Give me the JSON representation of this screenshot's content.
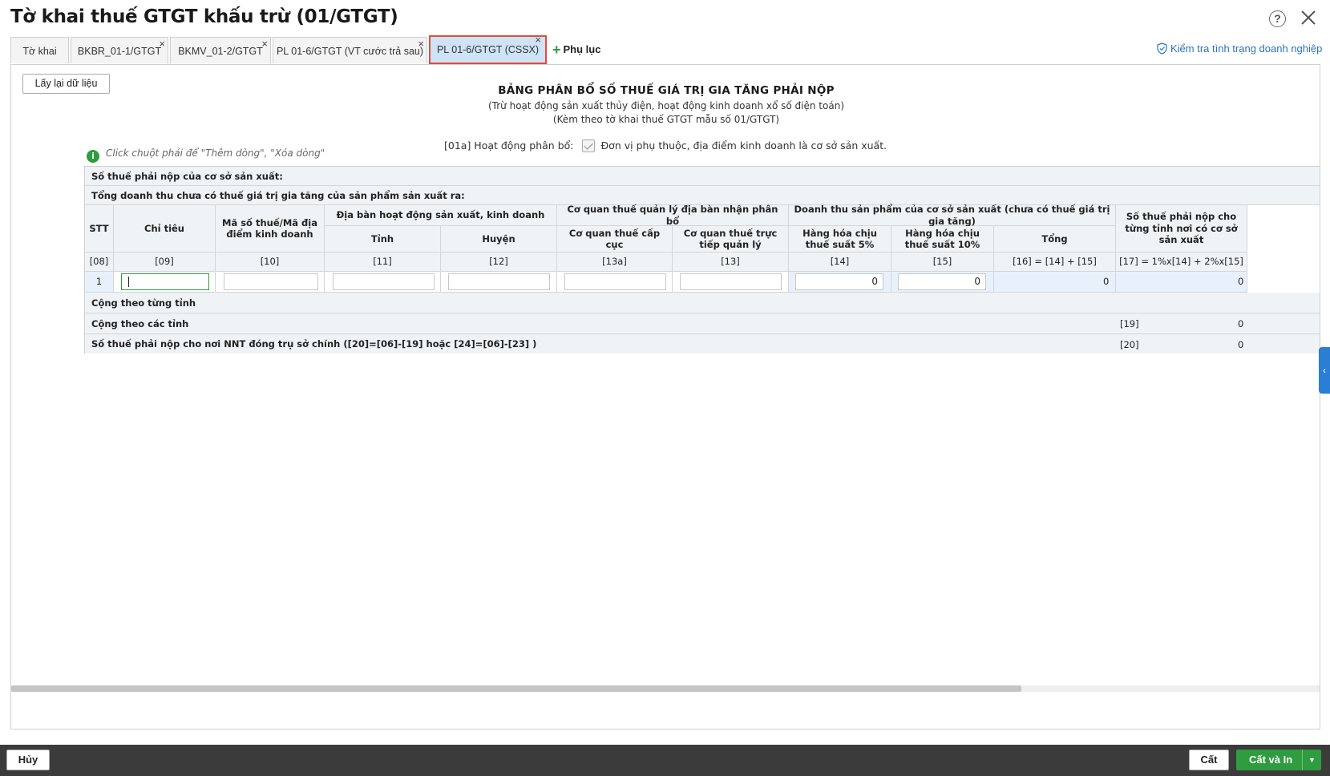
{
  "window": {
    "title": "Tờ khai thuế GTGT khấu trừ (01/GTGT)",
    "help_icon": "?"
  },
  "tabs": [
    {
      "label": "Tờ khai"
    },
    {
      "label": "BKBR_01-1/GTGT"
    },
    {
      "label": "BKMV_01-2/GTGT"
    },
    {
      "label": "PL 01-6/GTGT (VT cước trả sau)"
    },
    {
      "label": "PL 01-6/GTGT (CSSX)"
    }
  ],
  "tab_close_glyph": "×",
  "add_tab": {
    "plus": "+",
    "label": "Phụ lục"
  },
  "check_link": {
    "label": "Kiểm tra tình trạng doanh nghiệp"
  },
  "reload_button": {
    "label": "Lấy lại dữ liệu"
  },
  "form": {
    "title": "BẢNG PHÂN BỔ SỐ THUẾ GIÁ TRỊ GIA TĂNG PHẢI NỘP",
    "subtitle1": "(Trừ hoạt động sản xuất thủy điện, hoạt động kinh doanh xổ số điện toán)",
    "subtitle2": "(Kèm theo tờ khai thuế GTGT mẫu số 01/GTGT)",
    "alloc_label": "[01a] Hoạt động phân bổ:",
    "alloc_checkbox_label": "Đơn vị phụ thuộc, địa điểm kinh doanh là cơ sở sản xuất.",
    "alloc_checked": true,
    "hint_icon": "i",
    "hint": "Click chuột phải để \"Thêm dòng\", \"Xóa dòng\""
  },
  "grid": {
    "bar1": "Số thuế phải nộp của cơ sở sản xuất:",
    "bar2": "Tổng doanh thu chưa có thuế giá trị gia tăng của sản phẩm sản xuất ra:",
    "headers": {
      "stt": "STT",
      "chi_tieu": "Chỉ tiêu",
      "mst": "Mã số thuế/Mã địa điểm kinh doanh",
      "dia_ban": "Địa bàn hoạt động sản xuất, kinh doanh",
      "tinh": "Tỉnh",
      "huyen": "Huyện",
      "co_quan": "Cơ quan thuế quản lý địa bàn nhận phân bổ",
      "cap_cuc": "Cơ quan thuế cấp cục",
      "truc_tiep": "Cơ quan thuế trực tiếp quản lý",
      "doanh_thu": "Doanh thu sản phẩm của cơ sở sản xuất (chưa có thuế giá trị gia tăng)",
      "hh5": "Hàng hóa chịu thuế suất 5%",
      "hh10": "Hàng hóa chịu thuế suất 10%",
      "tong": "Tổng",
      "so_thue": "Số thuế phải nộp cho từng tỉnh nơi có cơ sở sản xuất"
    },
    "codes": [
      "[08]",
      "[09]",
      "[10]",
      "[11]",
      "[12]",
      "[13a]",
      "[13]",
      "[14]",
      "[15]",
      "[16] = [14] + [15]",
      "[17] = 1%x[14] + 2%x[15]"
    ],
    "row": {
      "stt": "1",
      "chi_tieu": "",
      "mst": "",
      "tinh": "",
      "huyen": "",
      "cap_cuc": "",
      "truc_tiep": "",
      "hh5": "0",
      "hh10": "0",
      "tong": "0",
      "so_thue": "0"
    },
    "sum_by_province": "Cộng theo từng tỉnh",
    "sum_all": "Cộng theo các tỉnh",
    "sum_all_code": "[19]",
    "sum_all_value": "0",
    "head_office": "Số thuế phải nộp cho nơi NNT đóng trụ sở chính ([20]=[06]-[19] hoặc [24]=[06]-[23] )",
    "head_office_code": "[20]",
    "head_office_value": "0"
  },
  "footer": {
    "cancel": "Hủy",
    "save": "Cất",
    "save_print": "Cất và In",
    "dropdown_glyph": "▼"
  },
  "side_toggle_glyph": "‹",
  "colors": {
    "accent_green": "#2e9c3f",
    "link_blue": "#2a72c6",
    "active_tab_border": "#e24b3b",
    "active_tab_bg": "#cfe3f7"
  }
}
